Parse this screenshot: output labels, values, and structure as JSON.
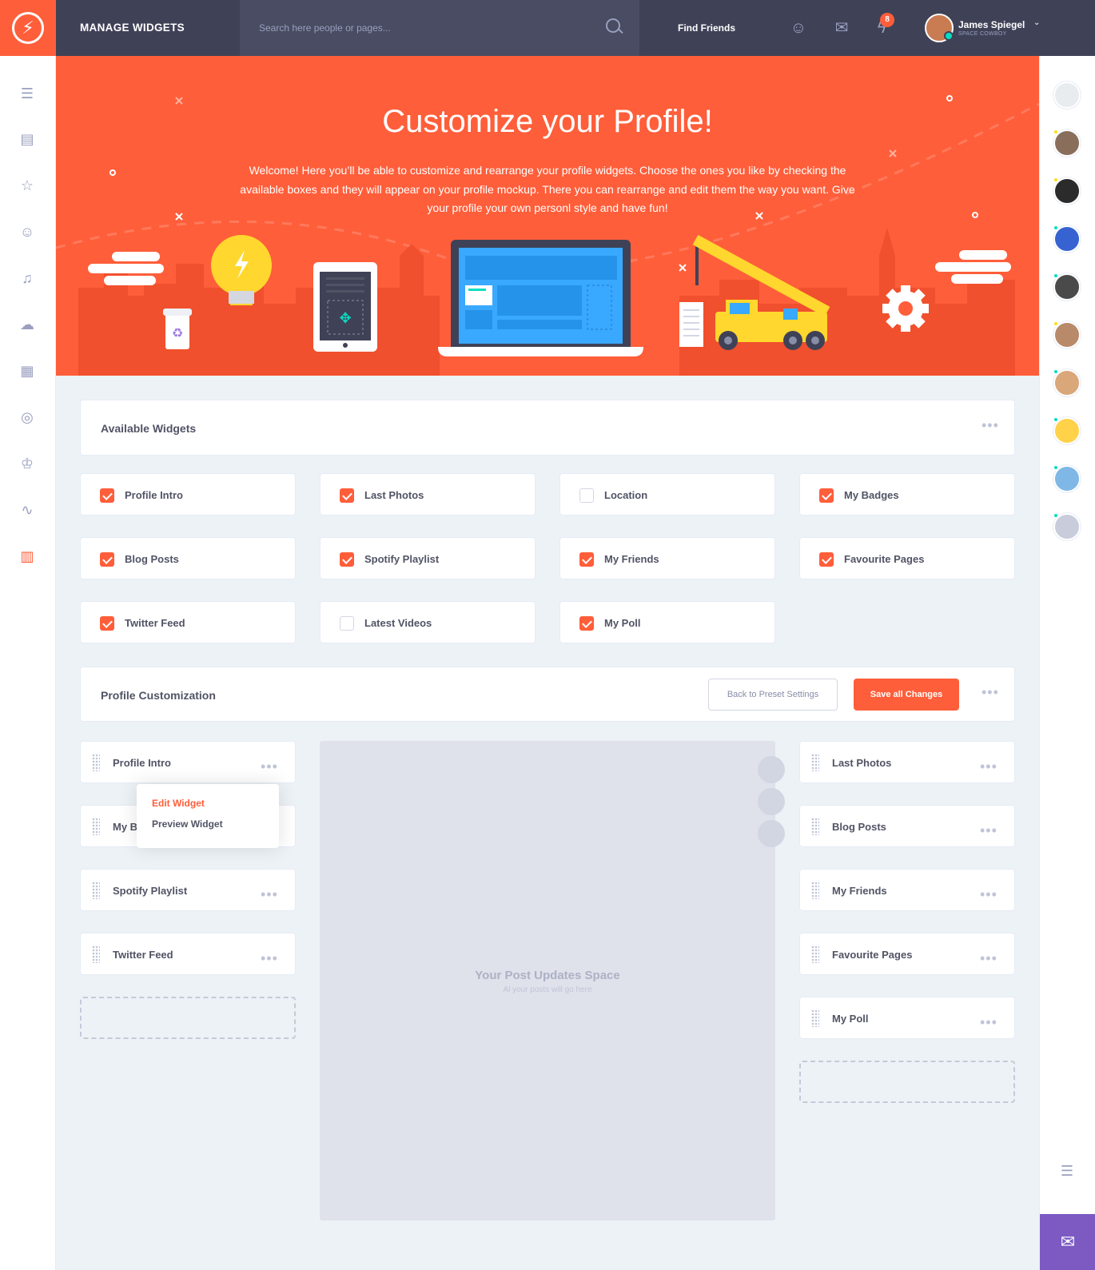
{
  "topbar": {
    "page_title": "MANAGE WIDGETS",
    "search_placeholder": "Search here people or pages...",
    "find_friends": "Find Friends",
    "notification_count": "8",
    "user_name": "James Spiegel",
    "user_subtitle": "SPACE COWBOY"
  },
  "hero": {
    "title": "Customize your Profile!",
    "text": "Welcome! Here you’ll be able to customize and rearrange your profile widgets. Choose the ones you like by checking the available boxes and they will appear on your profile mockup. There you can rearrange and edit them the way you want. Give your profile your own personl style and have fun!"
  },
  "available": {
    "title": "Available Widgets",
    "items": [
      {
        "label": "Profile Intro",
        "checked": true
      },
      {
        "label": "Last Photos",
        "checked": true
      },
      {
        "label": "Location",
        "checked": false
      },
      {
        "label": "My Badges",
        "checked": true
      },
      {
        "label": "Blog Posts",
        "checked": true
      },
      {
        "label": "Spotify Playlist",
        "checked": true
      },
      {
        "label": "My Friends",
        "checked": true
      },
      {
        "label": "Favourite Pages",
        "checked": true
      },
      {
        "label": "Twitter Feed",
        "checked": true
      },
      {
        "label": "Latest Videos",
        "checked": false
      },
      {
        "label": "My Poll",
        "checked": true
      }
    ]
  },
  "customization": {
    "title": "Profile Customization",
    "reset_label": "Back to Preset Settings",
    "save_label": "Save all Changes",
    "left_widgets": [
      "Profile Intro",
      "My B",
      "Spotify Playlist",
      "Twitter Feed"
    ],
    "right_widgets": [
      "Last Photos",
      "Blog Posts",
      "My Friends",
      "Favourite Pages",
      "My Poll"
    ],
    "dropdown": {
      "edit": "Edit Widget",
      "preview": "Preview Widget"
    },
    "post_space_title": "Your Post Updates Space",
    "post_space_sub": "Al your posts will go here"
  },
  "colors": {
    "accent": "#ff5e3a",
    "topbar": "#3f4257",
    "chat": "#7c5ac2",
    "online": "#08ddc1",
    "away": "#ffdc1b"
  }
}
